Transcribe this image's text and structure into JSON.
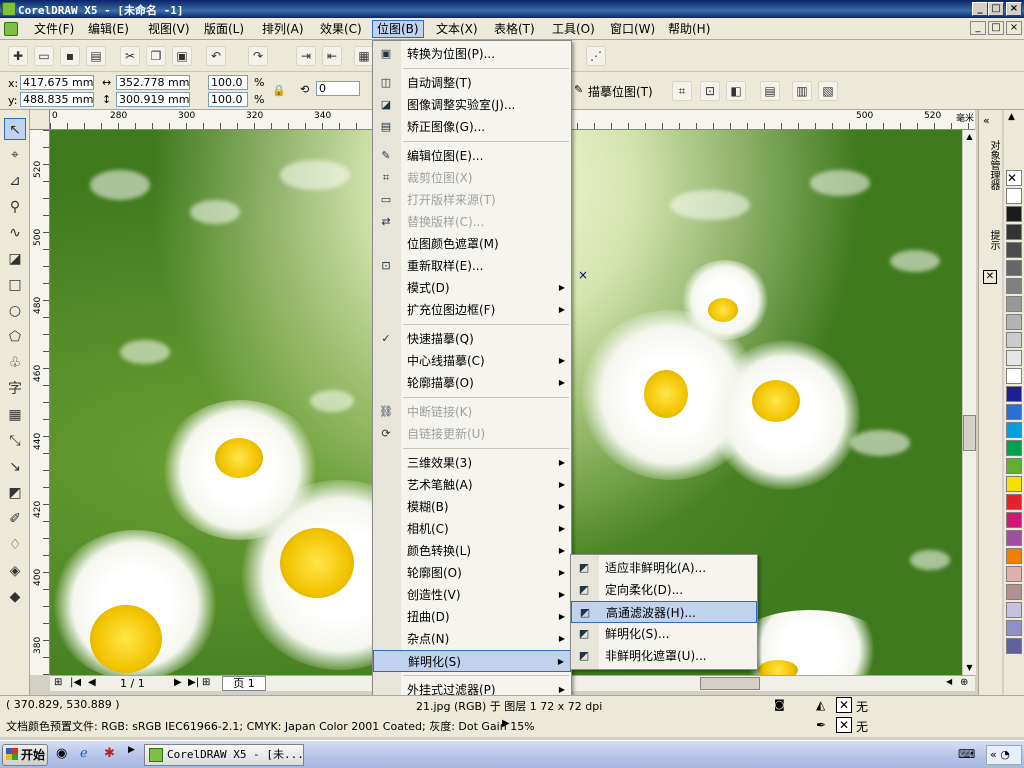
{
  "window": {
    "title": "CorelDRAW X5 - [未命名 -1]"
  },
  "menubar": [
    "文件(F)",
    "编辑(E)",
    "视图(V)",
    "版面(L)",
    "排列(A)",
    "效果(C)",
    "位图(B)",
    "文本(X)",
    "表格(T)",
    "工具(O)",
    "窗口(W)",
    "帮助(H)"
  ],
  "menubar_active": "位图(B)",
  "propbar": {
    "x_label": "x:",
    "x_value": "417.675 mm",
    "y_label": "y:",
    "y_value": "488.835 mm",
    "w_value": "352.778 mm",
    "h_value": "300.919 mm",
    "scale_x": "100.0",
    "scale_y": "100.0",
    "pct": "%",
    "angle": "0",
    "trace_label": "描摹位图(T)"
  },
  "hruler_ticks": [
    "0",
    "280",
    "300",
    "320",
    "340",
    "500",
    "520"
  ],
  "hruler_unit": "毫米",
  "vruler_ticks": [
    "520",
    "500",
    "480",
    "460",
    "440",
    "420",
    "400",
    "380"
  ],
  "bitmap_menu": [
    {
      "label": "转换为位图(P)...",
      "icon": "convert-icon",
      "enabled": true
    },
    {
      "sep": true
    },
    {
      "label": "自动调整(T)",
      "icon": "auto-adjust-icon",
      "enabled": true
    },
    {
      "label": "图像调整实验室(J)...",
      "icon": "lab-icon",
      "enabled": true
    },
    {
      "label": "矫正图像(G)...",
      "icon": "straighten-icon",
      "enabled": true
    },
    {
      "sep": true
    },
    {
      "label": "编辑位图(E)...",
      "icon": "edit-bitmap-icon",
      "enabled": true
    },
    {
      "label": "裁剪位图(X)",
      "icon": "crop-icon",
      "enabled": false
    },
    {
      "label": "打开版样来源(T)",
      "icon": "open-icon",
      "enabled": false
    },
    {
      "label": "替换版样(C)...",
      "icon": "replace-icon",
      "enabled": false
    },
    {
      "label": "位图颜色遮罩(M)",
      "icon": "",
      "enabled": true
    },
    {
      "label": "重新取样(E)...",
      "icon": "resample-icon",
      "enabled": true
    },
    {
      "label": "模式(D)",
      "icon": "",
      "enabled": true,
      "submenu": true
    },
    {
      "label": "扩充位图边框(F)",
      "icon": "",
      "enabled": true,
      "submenu": true
    },
    {
      "sep": true
    },
    {
      "label": "快速描摹(Q)",
      "icon": "quick-trace-icon",
      "enabled": true
    },
    {
      "label": "中心线描摹(C)",
      "icon": "",
      "enabled": true,
      "submenu": true
    },
    {
      "label": "轮廓描摹(O)",
      "icon": "",
      "enabled": true,
      "submenu": true
    },
    {
      "sep": true
    },
    {
      "label": "中断链接(K)",
      "icon": "break-link-icon",
      "enabled": false
    },
    {
      "label": "自链接更新(U)",
      "icon": "update-link-icon",
      "enabled": false
    },
    {
      "sep": true
    },
    {
      "label": "三维效果(3)",
      "icon": "",
      "enabled": true,
      "submenu": true
    },
    {
      "label": "艺术笔触(A)",
      "icon": "",
      "enabled": true,
      "submenu": true
    },
    {
      "label": "模糊(B)",
      "icon": "",
      "enabled": true,
      "submenu": true
    },
    {
      "label": "相机(C)",
      "icon": "",
      "enabled": true,
      "submenu": true
    },
    {
      "label": "颜色转换(L)",
      "icon": "",
      "enabled": true,
      "submenu": true
    },
    {
      "label": "轮廓图(O)",
      "icon": "",
      "enabled": true,
      "submenu": true
    },
    {
      "label": "创造性(V)",
      "icon": "",
      "enabled": true,
      "submenu": true
    },
    {
      "label": "扭曲(D)",
      "icon": "",
      "enabled": true,
      "submenu": true
    },
    {
      "label": "杂点(N)",
      "icon": "",
      "enabled": true,
      "submenu": true
    },
    {
      "label": "鲜明化(S)",
      "icon": "",
      "enabled": true,
      "submenu": true,
      "selected": true
    },
    {
      "sep": true
    },
    {
      "label": "外挂式过滤器(P)",
      "icon": "",
      "enabled": true,
      "submenu": true
    }
  ],
  "sharpen_submenu": [
    {
      "label": "适应非鲜明化(A)...",
      "icon": "adaptive-unsharp-icon"
    },
    {
      "label": "定向柔化(D)...",
      "icon": "directional-smooth-icon"
    },
    {
      "label": "高通滤波器(H)...",
      "icon": "high-pass-icon",
      "selected": true
    },
    {
      "label": "鲜明化(S)...",
      "icon": "sharpen-icon"
    },
    {
      "label": "非鲜明化遮罩(U)...",
      "icon": "unsharp-mask-icon"
    }
  ],
  "docker_labels": [
    "对象管理器",
    "提示"
  ],
  "page_nav": {
    "count": "1 / 1",
    "page_tab": "页 1"
  },
  "status": {
    "coords": "( 370.829, 530.889 )",
    "object_info": "21.jpg (RGB) 于 图层 1 72 x 72 dpi",
    "color_profile": "文档颜色预置文件: RGB: sRGB IEC61966-2.1; CMYK: Japan Color 2001 Coated; 灰度: Dot Gain 15%",
    "fill_none": "无",
    "outline_none": "无"
  },
  "taskbar": {
    "start": "开始",
    "task": "CorelDRAW X5 - [未..."
  },
  "palette_colors": [
    "#ffffff",
    "#1a1a1a",
    "#333333",
    "#4d4d4d",
    "#666666",
    "#808080",
    "#999999",
    "#b3b3b3",
    "#cccccc",
    "#e6e6e6",
    "#ffffff",
    "#1f1f8f",
    "#2a6fd6",
    "#00a0e0",
    "#00a050",
    "#60b030",
    "#f7e000",
    "#e8202a",
    "#d0187a",
    "#a050a0",
    "#f08000",
    "#e0b0b0",
    "#b09090",
    "#c8c0e0",
    "#9090c8",
    "#6060a0"
  ]
}
